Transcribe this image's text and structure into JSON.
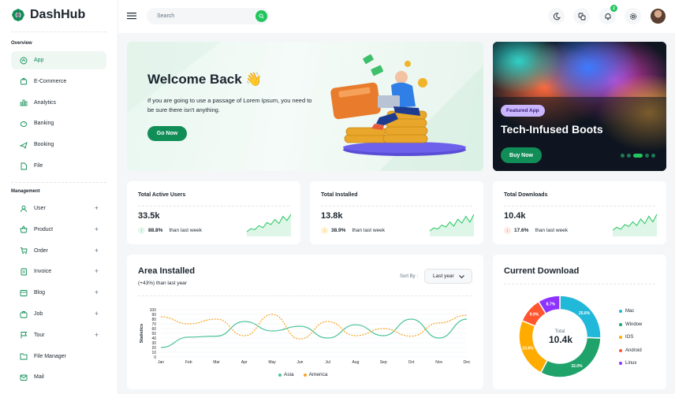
{
  "brand": {
    "name": "DashHub",
    "color": "#118d57"
  },
  "sidebar": {
    "overview_title": "Overview",
    "management_title": "Management",
    "overview_items": [
      {
        "label": "App",
        "icon": "app-icon",
        "active": true
      },
      {
        "label": "E-Commerce",
        "icon": "shopping-bag-icon"
      },
      {
        "label": "Analytics",
        "icon": "chart-icon"
      },
      {
        "label": "Banking",
        "icon": "piggy-bank-icon"
      },
      {
        "label": "Booking",
        "icon": "airplane-icon"
      },
      {
        "label": "File",
        "icon": "file-icon"
      }
    ],
    "management_items": [
      {
        "label": "User",
        "icon": "user-icon"
      },
      {
        "label": "Product",
        "icon": "basket-icon"
      },
      {
        "label": "Order",
        "icon": "cart-icon"
      },
      {
        "label": "Invoice",
        "icon": "invoice-icon"
      },
      {
        "label": "Blog",
        "icon": "blog-icon"
      },
      {
        "label": "Job",
        "icon": "briefcase-icon"
      },
      {
        "label": "Tour",
        "icon": "flag-icon"
      },
      {
        "label": "File Manager",
        "icon": "folder-icon"
      },
      {
        "label": "Mail",
        "icon": "mail-icon"
      }
    ]
  },
  "topbar": {
    "search_placeholder": "Search",
    "notification_count": "2"
  },
  "welcome": {
    "title": "Welcome Back 👋",
    "text": "If you are going to use a passage of Lorem Ipsum, you need to be sure there isn't anything.",
    "button": "Go Now"
  },
  "featured": {
    "tag": "Featured App",
    "title": "Tech-Infused Boots",
    "button": "Buy Now",
    "slides": 5,
    "active_slide": 3
  },
  "stats": [
    {
      "title": "Total Active Users",
      "value": "33.5k",
      "pct": "88.8%",
      "sub": "than last week",
      "trend": "up",
      "color": "#22c55e",
      "spark": [
        3,
        6,
        5,
        9,
        7,
        12,
        10,
        15,
        11,
        18,
        14,
        20
      ]
    },
    {
      "title": "Total Installed",
      "value": "13.8k",
      "pct": "38.9%",
      "sub": "than last week",
      "trend": "flat",
      "color": "#22c55e",
      "spark": [
        4,
        7,
        6,
        10,
        8,
        13,
        9,
        16,
        12,
        19,
        13,
        21
      ]
    },
    {
      "title": "Total Downloads",
      "value": "10.4k",
      "pct": "17.6%",
      "sub": "than last week",
      "trend": "down",
      "color": "#22c55e",
      "spark": [
        5,
        8,
        6,
        11,
        9,
        14,
        10,
        17,
        12,
        20,
        14,
        22
      ]
    }
  ],
  "area": {
    "title": "Area Installed",
    "subtitle": "(+43%) than last year",
    "sort_label": "Sort By :",
    "sort_value": "Last year"
  },
  "chart_data": {
    "type": "line",
    "categories": [
      "Jan",
      "Feb",
      "Mar",
      "Apr",
      "May",
      "Jun",
      "Jul",
      "Aug",
      "Sep",
      "Oct",
      "Nov",
      "Dec"
    ],
    "ylabel": "Statistics",
    "ylim": [
      0,
      100
    ],
    "yticks": [
      0,
      10,
      20,
      30,
      40,
      50,
      60,
      70,
      80,
      90,
      100
    ],
    "series": [
      {
        "name": "Asia",
        "color": "#4cc39a",
        "values": [
          20,
          42,
          44,
          75,
          55,
          65,
          40,
          68,
          45,
          80,
          40,
          80
        ]
      },
      {
        "name": "America",
        "color": "#f5a623",
        "values": [
          85,
          70,
          80,
          45,
          90,
          38,
          75,
          45,
          60,
          44,
          72,
          88
        ]
      }
    ]
  },
  "donut": {
    "title": "Current Download",
    "center_label": "Total",
    "center_value": "10.4k",
    "segments": [
      {
        "name": "Mac",
        "value": 25.6,
        "label": "25.6%",
        "color": "#22b8d9"
      },
      {
        "name": "Window",
        "value": 32.0,
        "label": "32.0%",
        "color": "#1fa36a"
      },
      {
        "name": "IOS",
        "value": 23.6,
        "label": "23.6%",
        "color": "#ffab00"
      },
      {
        "name": "Android",
        "value": 9.9,
        "label": "9.9%",
        "color": "#ff5630"
      },
      {
        "name": "Linux",
        "value": 8.7,
        "label": "8.7%",
        "color": "#8e33ff"
      }
    ]
  }
}
